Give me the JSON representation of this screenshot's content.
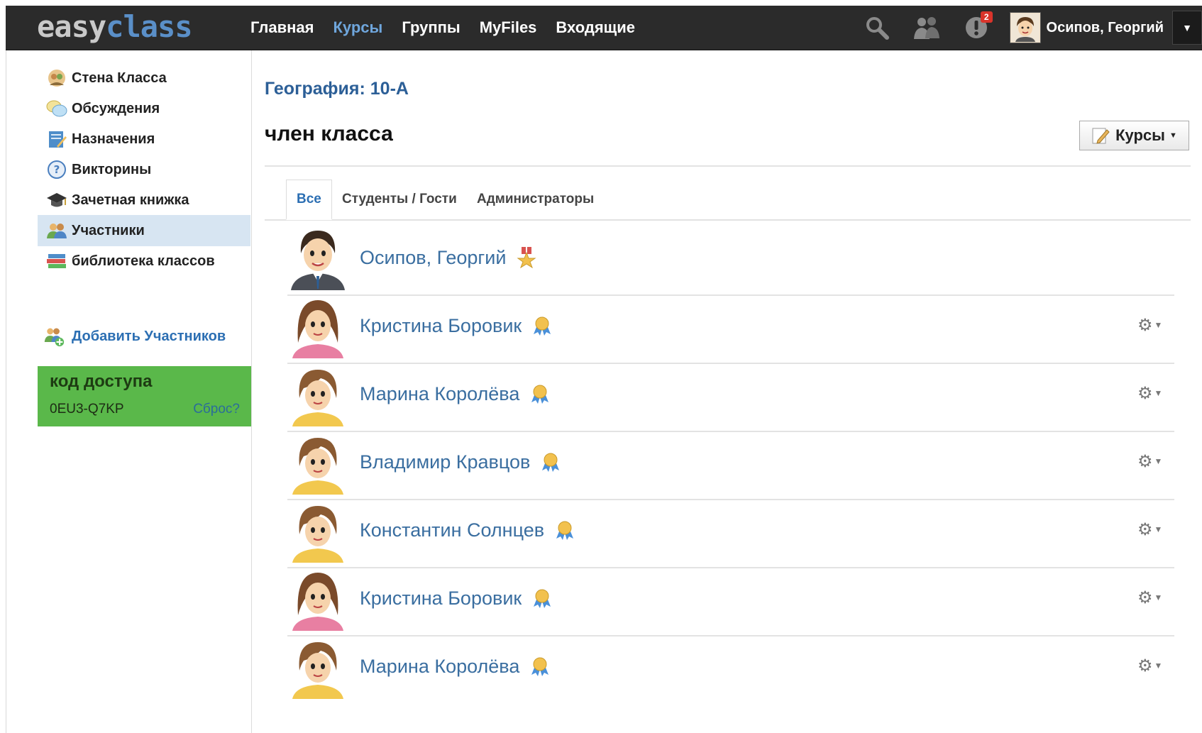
{
  "header": {
    "logo_part1": "easy",
    "logo_part2": "class",
    "nav": [
      "Главная",
      "Курсы",
      "Группы",
      "MyFiles",
      "Входящие"
    ],
    "notification_count": "2",
    "user_name": "Осипов, Георгий",
    "icons": [
      "search-icon",
      "people-icon",
      "alert-icon",
      "chevron-down-icon"
    ]
  },
  "sidebar": {
    "items": [
      {
        "label": "Стена Класса",
        "icon": "wall-icon"
      },
      {
        "label": "Обсуждения",
        "icon": "chat-bubbles-icon"
      },
      {
        "label": "Назначения",
        "icon": "assignment-icon"
      },
      {
        "label": "Викторины",
        "icon": "quiz-icon"
      },
      {
        "label": "Зачетная книжка",
        "icon": "graduation-cap-icon"
      },
      {
        "label": "Участники",
        "icon": "members-icon"
      },
      {
        "label": "библиотека классов",
        "icon": "library-icon"
      }
    ],
    "add_members": "Добавить Участников",
    "access": {
      "title": "код доступа",
      "code": "0EU3-Q7KP",
      "reset": "Сброс?"
    }
  },
  "main": {
    "course_title": "География: 10-А",
    "page_title": "член класса",
    "courses_button": "Курсы",
    "tabs": [
      "Все",
      "Студенты / Гости",
      "Администраторы"
    ],
    "members": [
      {
        "name": "Осипов, Георгий",
        "role": "owner"
      },
      {
        "name": "Кристина Боровик",
        "role": "student"
      },
      {
        "name": "Марина Королёва",
        "role": "student"
      },
      {
        "name": "Владимир Кравцов",
        "role": "student"
      },
      {
        "name": "Константин Солнцев",
        "role": "student"
      },
      {
        "name": "Кристина Боровик",
        "role": "student"
      },
      {
        "name": "Марина Королёва",
        "role": "student"
      }
    ]
  },
  "colors": {
    "topbar": "#2b2b2b",
    "accent": "#2c6fb3",
    "access_green": "#5ab84a",
    "active_sidebar": "#d7e5f2"
  }
}
